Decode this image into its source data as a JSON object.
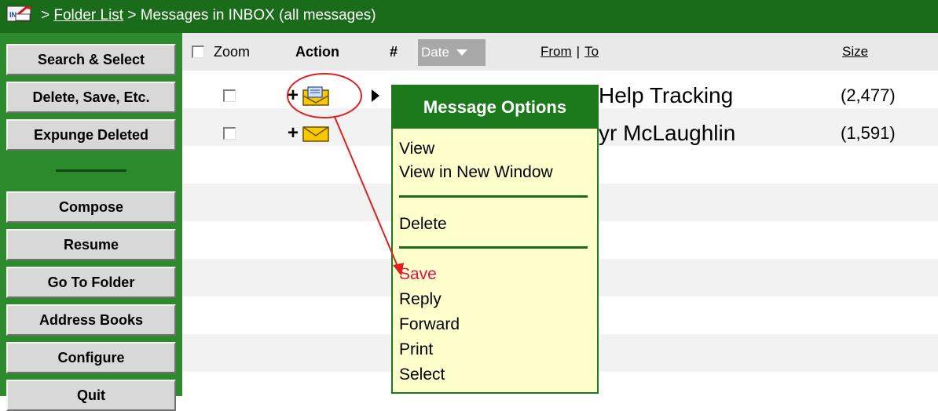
{
  "breadcrumb": {
    "prefix": " > ",
    "folder_list": "Folder List",
    "current": " > Messages in INBOX (all messages)"
  },
  "sidebar": {
    "search": "Search & Select",
    "delete_save": "Delete, Save, Etc.",
    "expunge": "Expunge Deleted",
    "compose": "Compose",
    "resume": "Resume",
    "goto_folder": "Go To Folder",
    "address_books": "Address Books",
    "configure": "Configure",
    "quit": "Quit"
  },
  "table": {
    "headers": {
      "zoom": "Zoom",
      "action": "Action",
      "number": "#",
      "date": "Date",
      "from": "From",
      "separator": "|",
      "to": "To",
      "size": "Size"
    },
    "rows": [
      {
        "action_plus": "+",
        "from_text": "Help Tracking",
        "size": "(2,477)"
      },
      {
        "action_plus": "+",
        "from_text": "yr McLaughlin",
        "size": "(1,591)"
      }
    ]
  },
  "menu": {
    "title": "Message Options",
    "items": {
      "view": "View",
      "view_new": "View in New Window",
      "delete": "Delete",
      "save": "Save",
      "reply": "Reply",
      "forward": "Forward",
      "print": "Print",
      "select": "Select"
    }
  },
  "colors": {
    "header_green": "#1a6b1a",
    "sidebar_green": "#2c8a2c",
    "menu_bg": "#ffffcc",
    "annotation_red": "#e02020"
  }
}
